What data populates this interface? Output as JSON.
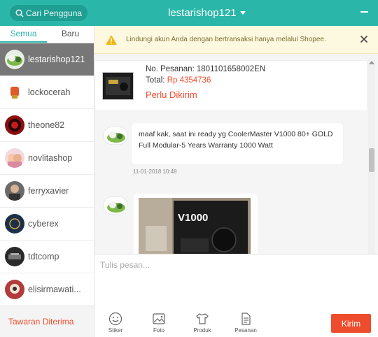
{
  "header": {
    "search_placeholder": "Cari Pengguna",
    "shop_name": "lestarishop121"
  },
  "sidebar": {
    "tabs": [
      {
        "label": "Semua",
        "active": true
      },
      {
        "label": "Baru",
        "active": false
      }
    ],
    "contacts": [
      {
        "name": "lestarishop121",
        "selected": true
      },
      {
        "name": "lockocerah",
        "selected": false
      },
      {
        "name": "theone82",
        "selected": false
      },
      {
        "name": "novlitashop",
        "selected": false
      },
      {
        "name": "ferryxavier",
        "selected": false
      },
      {
        "name": "cyberex",
        "selected": false
      },
      {
        "name": "tdtcomp",
        "selected": false
      },
      {
        "name": "elisirmawati...",
        "selected": false
      }
    ],
    "offers_label": "Tawaran Diterima"
  },
  "notice": {
    "text": "Lindungi akun Anda dengan bertransaksi hanya melalui Shopee."
  },
  "order": {
    "number_label": "No. Pesanan: 1801101658002EN",
    "total_label": "Total: ",
    "total_value": "Rp 4354736",
    "status": "Perlu Dikirim"
  },
  "messages": {
    "text_message": "maaf kak, saat ini ready yg CoolerMaster V1000 80+ GOLD Full Modular-5 Years Warranty 1000 Watt",
    "timestamp": "11-01-2018 10:48",
    "image_caption": "V1000"
  },
  "composer": {
    "placeholder": "Tulis pesan...",
    "tools": [
      {
        "label": "Stiker",
        "icon": "smiley-icon"
      },
      {
        "label": "Foto",
        "icon": "photo-icon"
      },
      {
        "label": "Produk",
        "icon": "shirt-icon"
      },
      {
        "label": "Pesanan",
        "icon": "document-icon"
      }
    ],
    "send_label": "Kirim"
  },
  "colors": {
    "brand_teal": "#2ab7a9",
    "accent_orange": "#ee4d2d",
    "notice_bg": "#fdf8e0"
  }
}
